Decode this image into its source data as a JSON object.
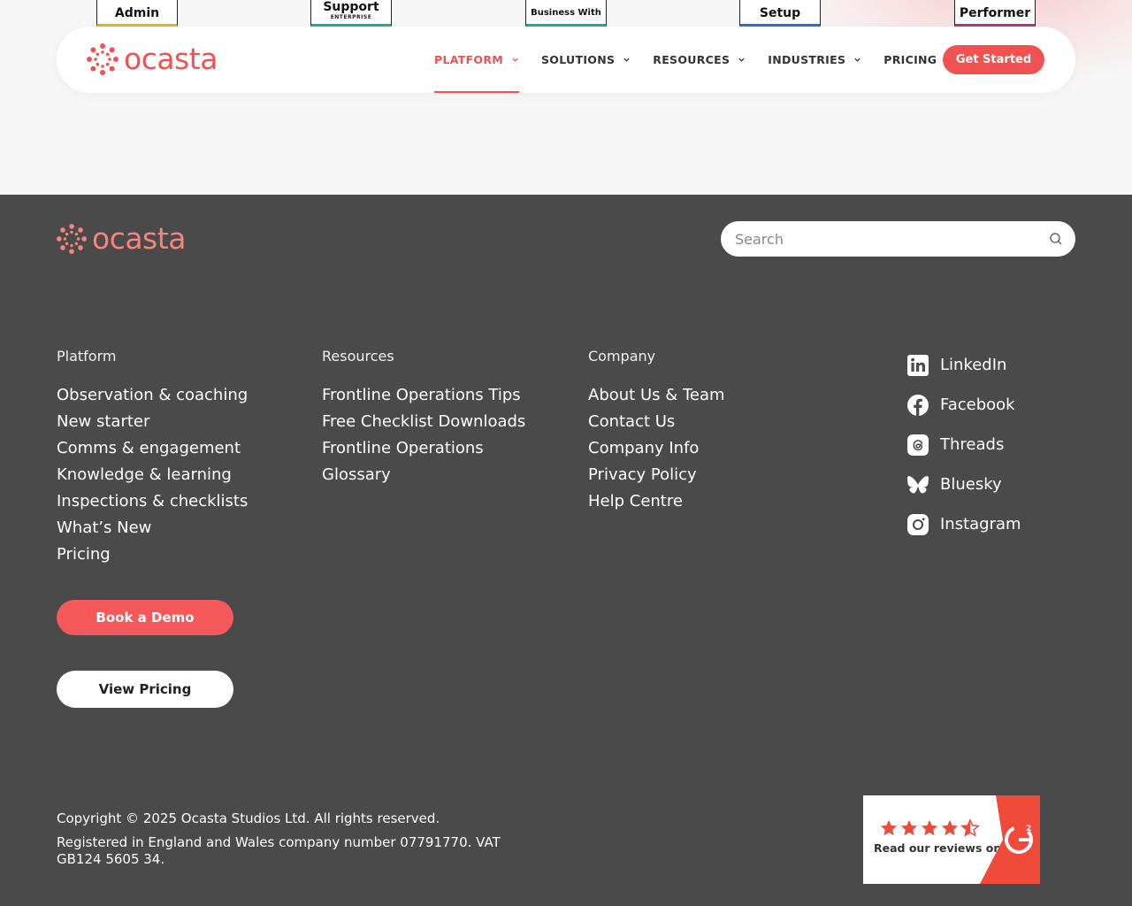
{
  "badges": [
    {
      "title": "Admin",
      "sub": ""
    },
    {
      "title": "Support",
      "sub": "ENTERPRISE"
    },
    {
      "title": "Business With",
      "sub": ""
    },
    {
      "title": "Setup",
      "sub": ""
    },
    {
      "title": "Performer",
      "sub": ""
    }
  ],
  "brand": {
    "name": "ocasta",
    "color": "#f15151"
  },
  "nav": {
    "items": [
      {
        "label": "PLATFORM",
        "dropdown": true,
        "active": true
      },
      {
        "label": "SOLUTIONS",
        "dropdown": true,
        "active": false
      },
      {
        "label": "RESOURCES",
        "dropdown": true,
        "active": false
      },
      {
        "label": "INDUSTRIES",
        "dropdown": true,
        "active": false
      },
      {
        "label": "PRICING",
        "dropdown": false,
        "active": false
      }
    ],
    "cta": "Get Started"
  },
  "search": {
    "placeholder": "Search",
    "value": ""
  },
  "columns": [
    {
      "title": "Platform",
      "links": [
        "Observation & coaching",
        "New starter",
        "Comms & engagement",
        "Knowledge & learning",
        "Inspections & checklists",
        "What’s New",
        "Pricing"
      ]
    },
    {
      "title": "Resources",
      "links": [
        "Frontline Operations Tips",
        "Free Checklist Downloads",
        "Frontline Operations",
        "Glossary"
      ]
    },
    {
      "title": "Company",
      "links": [
        "About Us & Team",
        "Contact Us",
        "Company Info",
        "Privacy Policy",
        "Help Centre"
      ]
    }
  ],
  "social": [
    {
      "label": "LinkedIn",
      "icon": "linkedin-icon"
    },
    {
      "label": "Facebook",
      "icon": "facebook-icon"
    },
    {
      "label": "Threads",
      "icon": "threads-icon"
    },
    {
      "label": "Bluesky",
      "icon": "bluesky-icon"
    },
    {
      "label": "Instagram",
      "icon": "instagram-icon"
    }
  ],
  "buttons": {
    "demo": "Book a Demo",
    "pricing": "View Pricing"
  },
  "legal": {
    "copyright": "Copyright © 2025 Ocasta Studios Ltd. All rights reserved.",
    "registration": "Registered in England and Wales company number 07791770. VAT GB124 5605 34."
  },
  "g2": {
    "text": "Read our reviews on",
    "rating": 4.5,
    "logo": "G2",
    "accent": "#ef4a3a"
  }
}
